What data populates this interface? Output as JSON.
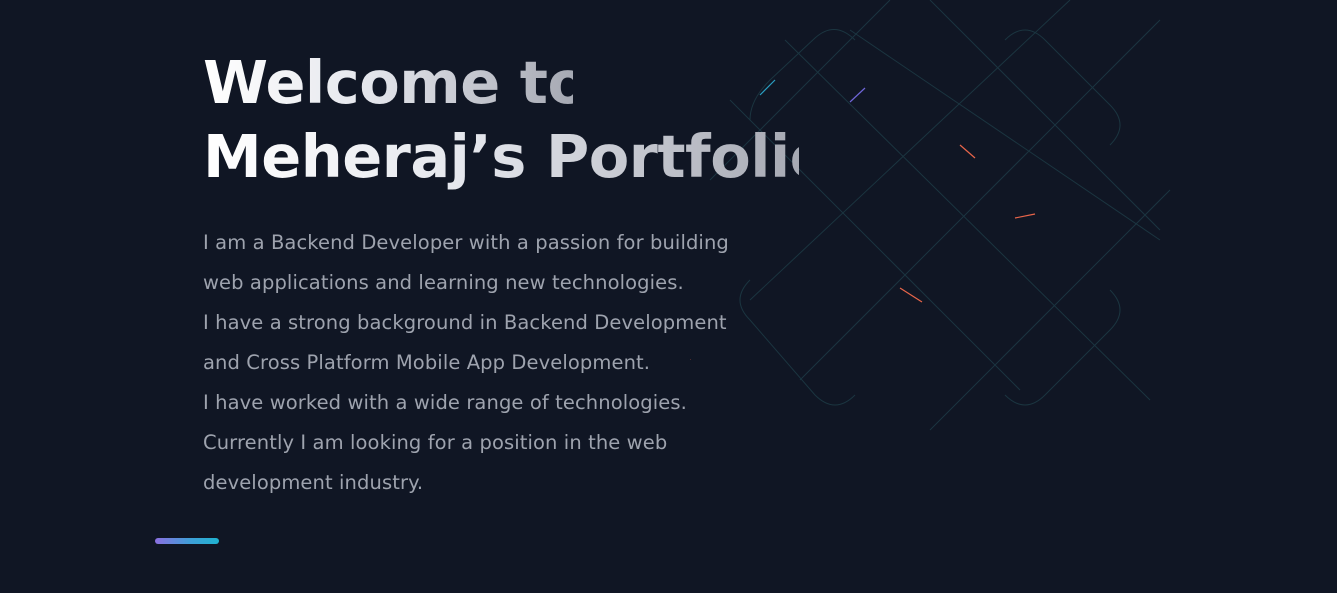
{
  "hero": {
    "title_line_1": "Welcome to",
    "title_line_2": "Meheraj’s Portfolio",
    "bio_lines": [
      "I am a Backend Developer with a passion for building",
      "web applications and learning new technologies.",
      "I have a strong background in Backend Development",
      "and Cross Platform Mobile App Development.",
      "I have worked with a wide range of technologies.",
      "Currently I am looking for a position in the web",
      "development industry."
    ]
  },
  "colors": {
    "background": "#101624",
    "title_text": "#eef0f4",
    "bio_text": "#9ea3ae",
    "accent_gradient_start": "#8b6fe0",
    "accent_gradient_end": "#1fb3d0",
    "pattern_line": "#1c3a44",
    "pattern_spark": "#f26b4f"
  }
}
